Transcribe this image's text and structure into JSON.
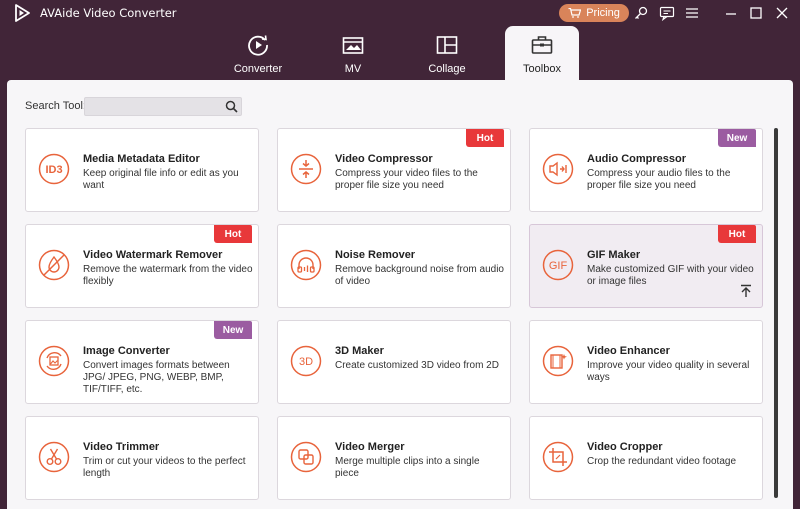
{
  "app": {
    "title": "AVAide Video Converter",
    "pricing_label": "Pricing",
    "accent": "#d9845a"
  },
  "tabs": [
    {
      "label": "Converter",
      "icon": "converter-icon",
      "active": false
    },
    {
      "label": "MV",
      "icon": "mv-icon",
      "active": false
    },
    {
      "label": "Collage",
      "icon": "collage-icon",
      "active": false
    },
    {
      "label": "Toolbox",
      "icon": "toolbox-icon",
      "active": true
    }
  ],
  "search": {
    "label": "Search Tool:",
    "value": "",
    "placeholder": ""
  },
  "tools": [
    {
      "title": "Media Metadata Editor",
      "desc": "Keep original file info or edit as you want",
      "icon": "id3-icon",
      "badge": ""
    },
    {
      "title": "Video Compressor",
      "desc": "Compress your video files to the proper file size you need",
      "icon": "compress-icon",
      "badge": "Hot"
    },
    {
      "title": "Audio Compressor",
      "desc": "Compress your audio files to the proper file size you need",
      "icon": "audio-compress-icon",
      "badge": "New"
    },
    {
      "title": "Video Watermark Remover",
      "desc": "Remove the watermark from the video flexibly",
      "icon": "watermark-remover-icon",
      "badge": "Hot"
    },
    {
      "title": "Noise Remover",
      "desc": "Remove background noise from audio of video",
      "icon": "noise-remover-icon",
      "badge": ""
    },
    {
      "title": "GIF Maker",
      "desc": "Make customized GIF with your video or image files",
      "icon": "gif-icon",
      "badge": "Hot"
    },
    {
      "title": "Image Converter",
      "desc": "Convert images formats between JPG/ JPEG, PNG, WEBP, BMP, TIF/TIFF, etc.",
      "icon": "image-convert-icon",
      "badge": "New"
    },
    {
      "title": "3D Maker",
      "desc": "Create customized 3D video from 2D",
      "icon": "3d-icon",
      "badge": ""
    },
    {
      "title": "Video Enhancer",
      "desc": "Improve your video quality in several ways",
      "icon": "enhancer-icon",
      "badge": ""
    },
    {
      "title": "Video Trimmer",
      "desc": "Trim or cut your videos to the perfect length",
      "icon": "scissors-icon",
      "badge": ""
    },
    {
      "title": "Video Merger",
      "desc": "Merge multiple clips into a single piece",
      "icon": "merge-icon",
      "badge": ""
    },
    {
      "title": "Video Cropper",
      "desc": "Crop the redundant video footage",
      "icon": "crop-icon",
      "badge": ""
    }
  ],
  "colors": {
    "background": "#412538",
    "hot": "#e8383a",
    "new": "#9b5ca1",
    "icon": "#e8643c"
  }
}
